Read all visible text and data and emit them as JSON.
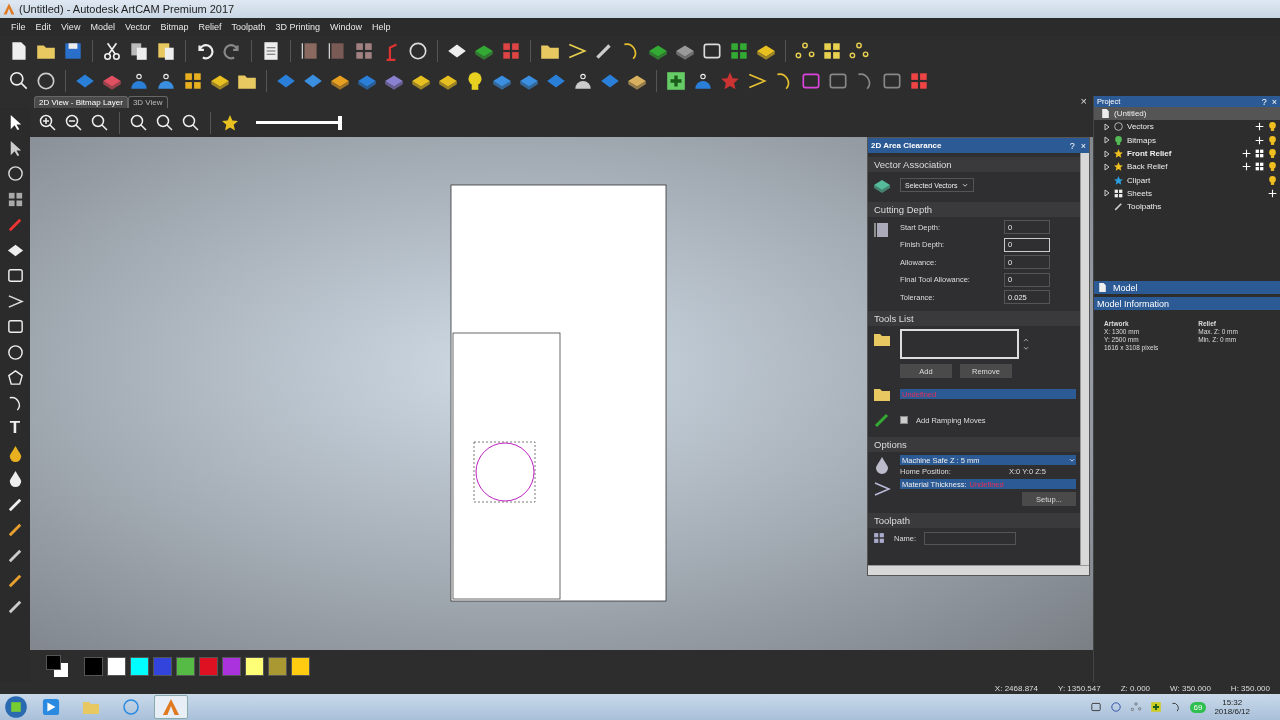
{
  "window": {
    "title": "(Untitled) - Autodesk ArtCAM Premium 2017"
  },
  "menu": [
    "File",
    "Edit",
    "View",
    "Model",
    "Vector",
    "Bitmap",
    "Relief",
    "Toolpath",
    "3D Printing",
    "Window",
    "Help"
  ],
  "view_tabs": [
    {
      "label": "2D View - Bitmap Layer",
      "selected": true
    },
    {
      "label": "3D View",
      "selected": false
    }
  ],
  "zoom_slider": {
    "level": 1
  },
  "text_tool": "T",
  "area_clearance": {
    "title": "2D Area Clearance",
    "help": "?",
    "close": "×",
    "vector_association": {
      "heading": "Vector Association",
      "dropdown": "Selected Vectors"
    },
    "cutting_depth": {
      "heading": "Cutting Depth",
      "fields": [
        {
          "label": "Start Depth:",
          "value": "0",
          "focused": false
        },
        {
          "label": "Finish Depth:",
          "value": "0",
          "focused": true
        },
        {
          "label": "Allowance:",
          "value": "0",
          "focused": false
        },
        {
          "label": "Final Tool Allowance:",
          "value": "0",
          "focused": false
        },
        {
          "label": "Tolerance:",
          "value": "0.025",
          "focused": false
        }
      ]
    },
    "tools_list": {
      "heading": "Tools List",
      "buttons": [
        "Add",
        "Remove"
      ],
      "tool": "Undefined"
    },
    "ramping": {
      "label": "Add Ramping Moves",
      "checked": false
    },
    "options": {
      "heading": "Options",
      "safe_z": "Machine Safe Z : 5 mm",
      "home_label": "Home Position:",
      "home_value": "X:0 Y:0 Z:5",
      "material_label": "Material Thickness:",
      "material_value": "Undefined",
      "setup": "Setup..."
    },
    "toolpath": {
      "heading": "Toolpath",
      "name_label": "Name:"
    }
  },
  "project": {
    "title": "Project",
    "help": "?",
    "close": "×",
    "root": {
      "label": "(Untitled)",
      "selected": true
    },
    "items": [
      {
        "label": "Vectors",
        "kind": "branch",
        "active": false
      },
      {
        "label": "Bitmaps",
        "kind": "branch",
        "active": false
      },
      {
        "label": "Front Relief",
        "kind": "branch",
        "active": true
      },
      {
        "label": "Back Relief",
        "kind": "branch",
        "active": false
      },
      {
        "label": "Clipart",
        "kind": "leaf",
        "active": false
      },
      {
        "label": "Sheets",
        "kind": "branch",
        "active": false
      },
      {
        "label": "Toolpaths",
        "kind": "leaf",
        "active": false
      }
    ]
  },
  "model": {
    "title": "Model",
    "info_heading": "Model Information",
    "columns": [
      {
        "heading": "Artwork",
        "lines": [
          "X: 1300 mm",
          "Y: 2500 mm",
          "1616 x 3108 pixels"
        ]
      },
      {
        "heading": "Relief",
        "lines": [
          "Max. Z: 0 mm",
          "Min. Z: 0 mm"
        ]
      }
    ]
  },
  "palette": [
    {
      "color": "#000000"
    },
    {
      "color": "#ffffff"
    },
    {
      "color": "#00ffff"
    },
    {
      "color": "#3344dd"
    },
    {
      "color": "#55bb44"
    },
    {
      "color": "#dd1122"
    },
    {
      "color": "#aa33dd"
    },
    {
      "color": "#ffff77"
    },
    {
      "color": "#aa9933"
    },
    {
      "color": "#ffcc11"
    }
  ],
  "status_bar": [
    "X: 2468.874",
    "Y: 1350.547",
    "Z: 0.000",
    "W: 350.000",
    "H: 350.000"
  ],
  "taskbar": {
    "badge": "69",
    "time": "15:32",
    "date": "2018/6/12"
  }
}
